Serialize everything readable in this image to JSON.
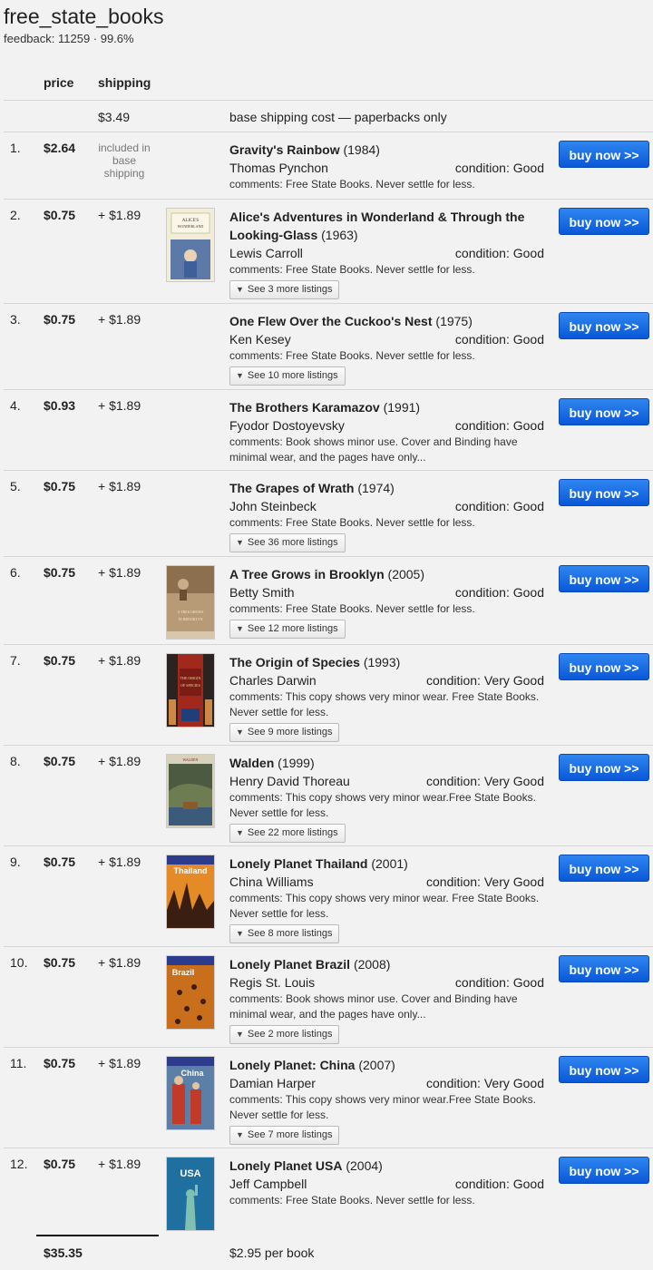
{
  "store": {
    "name": "free_state_books",
    "feedback": "feedback: 11259 · 99.6%"
  },
  "headers": {
    "price": "price",
    "shipping": "shipping"
  },
  "base": {
    "cost": "$3.49",
    "description": "base shipping cost — paperbacks only"
  },
  "buy_label": "buy now >>",
  "listings": [
    {
      "idx": "1.",
      "price": "$2.64",
      "shipping": "included in base shipping",
      "title": "Gravity's Rainbow",
      "year": "(1984)",
      "author": "Thomas Pynchon",
      "condition": "condition: Good",
      "comments": "comments: Free State Books. Never settle for less.",
      "more": "",
      "cover": ""
    },
    {
      "idx": "2.",
      "price": "$0.75",
      "shipping": "+ $1.89",
      "title": "Alice's Adventures in Wonderland & Through the Looking-Glass",
      "year": "(1963)",
      "author": "Lewis Carroll",
      "condition": "condition: Good",
      "comments": "comments: Free State Books. Never settle for less.",
      "more": "See 3 more listings",
      "cover": "alice",
      "cover_text": "ALICE'S ADVENTURES IN WONDERLAND"
    },
    {
      "idx": "3.",
      "price": "$0.75",
      "shipping": "+ $1.89",
      "title": "One Flew Over the Cuckoo's Nest",
      "year": "(1975)",
      "author": "Ken Kesey",
      "condition": "condition: Good",
      "comments": "comments: Free State Books. Never settle for less.",
      "more": "See 10 more listings",
      "cover": ""
    },
    {
      "idx": "4.",
      "price": "$0.93",
      "shipping": "+ $1.89",
      "title": "The Brothers Karamazov",
      "year": "(1991)",
      "author": "Fyodor Dostoyevsky",
      "condition": "condition: Good",
      "comments": "comments: Book shows minor use. Cover and Binding have minimal wear, and the pages have only...",
      "more": "",
      "cover": ""
    },
    {
      "idx": "5.",
      "price": "$0.75",
      "shipping": "+ $1.89",
      "title": "The Grapes of Wrath",
      "year": "(1974)",
      "author": "John Steinbeck",
      "condition": "condition: Good",
      "comments": "comments: Free State Books. Never settle for less.",
      "more": "See 36 more listings",
      "cover": ""
    },
    {
      "idx": "6.",
      "price": "$0.75",
      "shipping": "+ $1.89",
      "title": "A Tree Grows in Brooklyn",
      "year": "(2005)",
      "author": "Betty Smith",
      "condition": "condition: Good",
      "comments": "comments: Free State Books. Never settle for less.",
      "more": "See 12 more listings",
      "cover": "tree",
      "cover_text": "A TREE GROWS IN BROOKLYN"
    },
    {
      "idx": "7.",
      "price": "$0.75",
      "shipping": "+ $1.89",
      "title": "The Origin of Species",
      "year": "(1993)",
      "author": "Charles Darwin",
      "condition": "condition: Very Good",
      "comments": "comments: This copy shows very minor wear. Free State Books. Never settle for less.",
      "more": "See 9 more listings",
      "cover": "origin",
      "cover_text": "THE ORIGIN OF SPECIES"
    },
    {
      "idx": "8.",
      "price": "$0.75",
      "shipping": "+ $1.89",
      "title": "Walden",
      "year": "(1999)",
      "author": "Henry David Thoreau",
      "condition": "condition: Very Good",
      "comments": "comments: This copy shows very minor wear.Free State Books. Never settle for less.",
      "more": "See 22 more listings",
      "cover": "walden",
      "cover_text": "WALDEN"
    },
    {
      "idx": "9.",
      "price": "$0.75",
      "shipping": "+ $1.89",
      "title": "Lonely Planet Thailand",
      "year": "(2001)",
      "author": "China Williams",
      "condition": "condition: Very Good",
      "comments": "comments: This copy shows very minor wear. Free State Books. Never settle for less.",
      "more": "See 8 more listings",
      "cover": "thailand",
      "cover_text": "Thailand"
    },
    {
      "idx": "10.",
      "price": "$0.75",
      "shipping": "+ $1.89",
      "title": "Lonely Planet Brazil",
      "year": "(2008)",
      "author": "Regis St. Louis",
      "condition": "condition: Good",
      "comments": "comments: Book shows minor use. Cover and Binding have minimal wear, and the pages have only...",
      "more": "See 2 more listings",
      "cover": "brazil",
      "cover_text": "Brazil"
    },
    {
      "idx": "11.",
      "price": "$0.75",
      "shipping": "+ $1.89",
      "title": "Lonely Planet: China",
      "year": "(2007)",
      "author": "Damian Harper",
      "condition": "condition: Very Good",
      "comments": "comments: This copy shows very minor wear.Free State Books. Never settle for less.",
      "more": "See 7 more listings",
      "cover": "china",
      "cover_text": "China"
    },
    {
      "idx": "12.",
      "price": "$0.75",
      "shipping": "+ $1.89",
      "title": "Lonely Planet USA",
      "year": "(2004)",
      "author": "Jeff Campbell",
      "condition": "condition: Good",
      "comments": "comments: Free State Books. Never settle for less.",
      "more": "",
      "cover": "usa",
      "cover_text": "USA"
    }
  ],
  "totals": {
    "total": "$35.35",
    "per_book": "$2.95 per book"
  }
}
